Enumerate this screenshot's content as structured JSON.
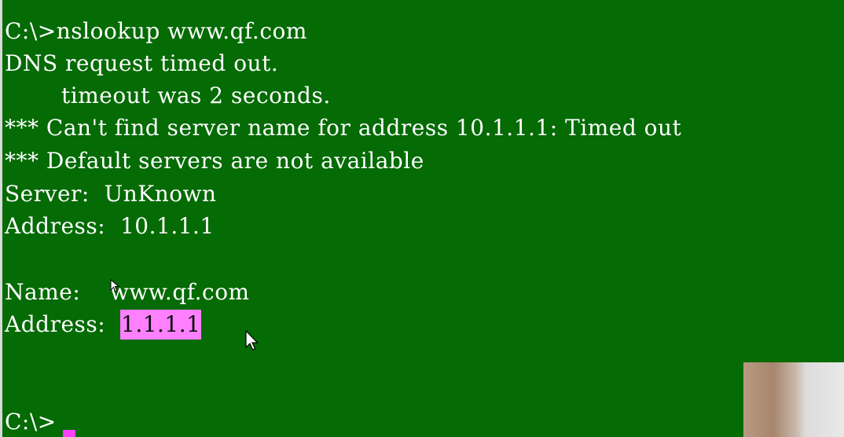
{
  "terminal": {
    "lines": [
      "C:\\>nslookup www.qf.com",
      "DNS request timed out.",
      "timeout was 2 seconds.",
      "*** Can't find server name for address 10.1.1.1: Timed out",
      "*** Default servers are not available",
      "Server:  UnKnown",
      "Address:  10.1.1.1",
      "Name:    www.qf.com",
      "Address:  "
    ],
    "selected_address": "1.1.1.1",
    "prompt": "C:\\>"
  },
  "colors": {
    "background": "#056b05",
    "text": "#ffffff",
    "selection": "#ff80ff",
    "caret": "#ff40ff"
  },
  "icons": {
    "mouse_cursor": "arrow-cursor-icon"
  }
}
